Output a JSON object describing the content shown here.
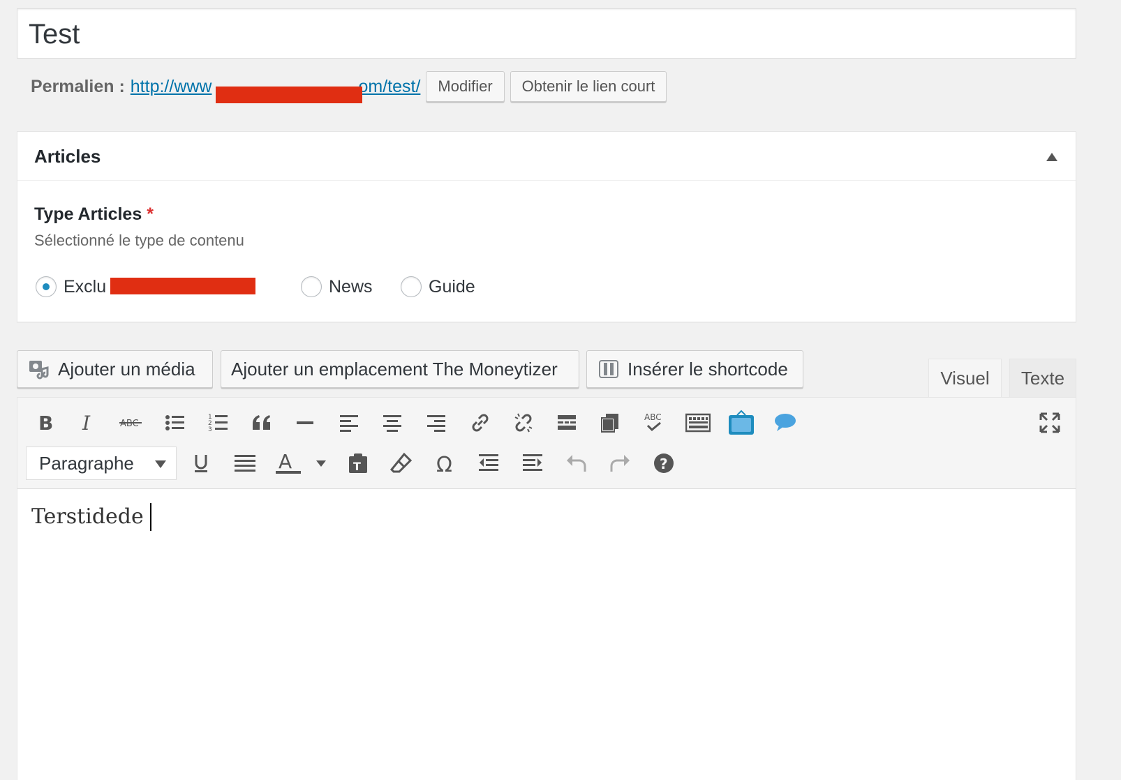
{
  "post": {
    "title": "Test"
  },
  "permalink": {
    "label": "Permalien :",
    "url_visible_start": "http://www",
    "url_visible_end": "om/test/",
    "edit_button": "Modifier",
    "shortlink_button": "Obtenir le lien court"
  },
  "metabox": {
    "title": "Articles",
    "field_label": "Type Articles",
    "required_mark": "*",
    "description": "Sélectionné le type de contenu",
    "options": [
      {
        "label": "Exclu",
        "checked": true
      },
      {
        "label": "News",
        "checked": false
      },
      {
        "label": "Guide",
        "checked": false
      }
    ]
  },
  "media_buttons": {
    "add_media": "Ajouter un média",
    "moneytizer": "Ajouter un emplacement The Moneytizer",
    "shortcode": "Insérer le shortcode"
  },
  "editor_tabs": {
    "visual": "Visuel",
    "text": "Texte",
    "active": "visual"
  },
  "toolbar": {
    "format_select": "Paragraphe",
    "row1_icons": [
      "bold-icon",
      "italic-icon",
      "strikethrough-icon",
      "bulleted-list-icon",
      "numbered-list-icon",
      "blockquote-icon",
      "horizontal-line-icon",
      "align-left-icon",
      "align-center-icon",
      "align-right-icon",
      "link-icon",
      "unlink-icon",
      "read-more-icon",
      "copy-icon",
      "spellcheck-icon",
      "keyboard-icon",
      "tv-icon",
      "speech-bubble-icon",
      "fullscreen-icon"
    ],
    "row2_icons": [
      "underline-icon",
      "justify-icon",
      "text-color-icon",
      "paste-text-icon",
      "clear-formatting-icon",
      "special-character-icon",
      "outdent-icon",
      "indent-icon",
      "undo-icon",
      "redo-icon",
      "help-icon"
    ],
    "accent": "#1e8cbe",
    "redaction_color": "#e02e12"
  },
  "editor": {
    "content": "Terstidede"
  }
}
